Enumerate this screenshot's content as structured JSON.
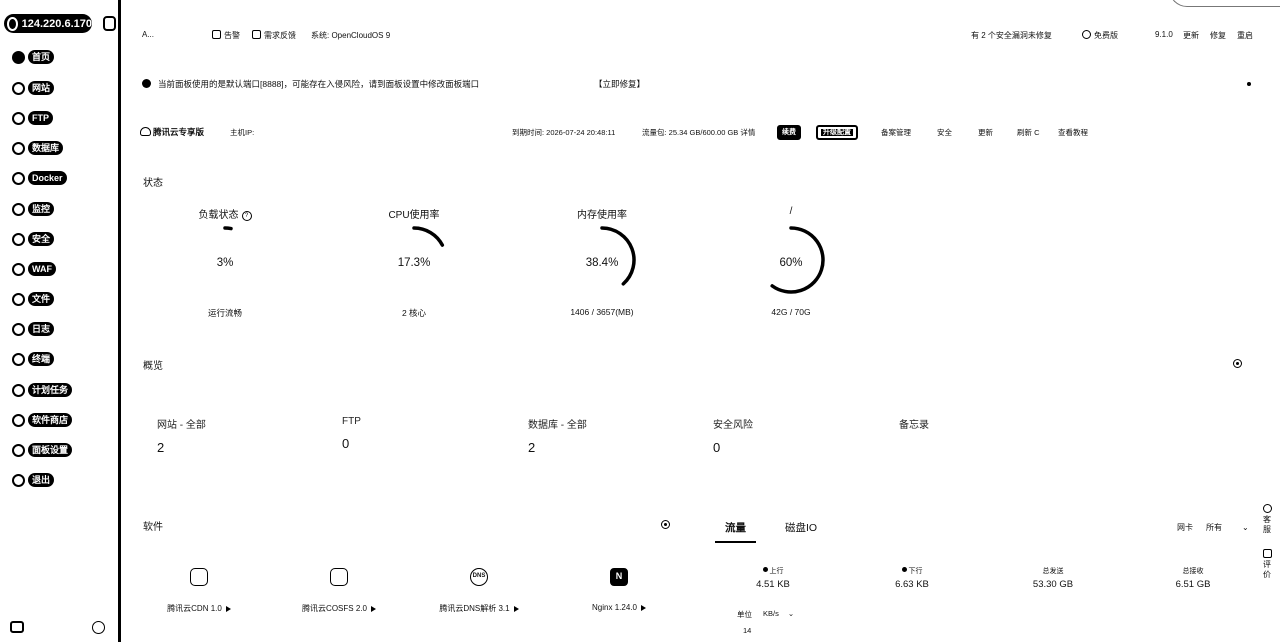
{
  "server": {
    "ip": "124.220.6.170"
  },
  "sidebar": {
    "items": [
      {
        "label": "首页",
        "icon": "home-icon"
      },
      {
        "label": "网站",
        "icon": "globe-icon"
      },
      {
        "label": "FTP",
        "icon": "ftp-icon"
      },
      {
        "label": "数据库",
        "icon": "database-icon"
      },
      {
        "label": "Docker",
        "icon": "docker-icon"
      },
      {
        "label": "监控",
        "icon": "monitor-icon"
      },
      {
        "label": "安全",
        "icon": "shield-icon"
      },
      {
        "label": "WAF",
        "icon": "waf-icon"
      },
      {
        "label": "文件",
        "icon": "folder-icon"
      },
      {
        "label": "日志",
        "icon": "log-icon"
      },
      {
        "label": "终端",
        "icon": "terminal-icon"
      },
      {
        "label": "计划任务",
        "icon": "clock-icon"
      },
      {
        "label": "软件商店",
        "icon": "store-icon"
      },
      {
        "label": "面板设置",
        "icon": "gear-icon"
      },
      {
        "label": "退出",
        "icon": "logout-icon"
      }
    ]
  },
  "topbar": {
    "user": "A...",
    "alert": "告警",
    "feedback": "需求反馈",
    "system": "系统: OpenCloudOS 9",
    "notice": "有 2 个安全漏洞未修复",
    "edition": "免费版",
    "version": "9.1.0",
    "update": "更新",
    "repair": "修复",
    "restart": "重启"
  },
  "warning": {
    "text": "当前面板使用的是默认端口[8888]，可能存在入侵风险，请到面板设置中修改面板端口",
    "link": "【立即修复】"
  },
  "info": {
    "brand": "腾讯云专享版",
    "host": "主机IP:",
    "expire": "到期时间: 2026-07-24 20:48:11",
    "traffic": "流量包: 25.34 GB/600.00 GB 详情",
    "renew_btn": "续费",
    "upgrade_btn": "升级配置",
    "links": [
      "备案管理",
      "安全",
      "更新",
      "刷新 C",
      "查看教程"
    ]
  },
  "status": {
    "title": "状态",
    "load": {
      "title": "负载状态",
      "value": "3%",
      "sub": "运行流畅",
      "percent": 0.03
    },
    "cpu": {
      "title": "CPU使用率",
      "value": "17.3%",
      "sub": "2 核心",
      "percent": 0.173
    },
    "mem": {
      "title": "内存使用率",
      "value": "38.4%",
      "sub": "1406 / 3657(MB)",
      "percent": 0.384
    },
    "disk": {
      "title": "/",
      "value": "60%",
      "sub": "42G / 70G",
      "percent": 0.6
    }
  },
  "overview": {
    "title": "概览",
    "items": [
      {
        "label": "网站 - 全部",
        "value": "2"
      },
      {
        "label": "FTP",
        "value": "0"
      },
      {
        "label": "数据库 - 全部",
        "value": "2"
      },
      {
        "label": "安全风险",
        "value": "0"
      },
      {
        "label": "备忘录",
        "value": ""
      }
    ]
  },
  "software": {
    "title": "软件",
    "items": [
      {
        "name": "腾讯云CDN 1.0",
        "icon": "cdn-icon"
      },
      {
        "name": "腾讯云COSFS 2.0",
        "icon": "cos-icon"
      },
      {
        "name": "腾讯云DNS解析 3.1",
        "icon": "dns-icon",
        "badge": "DNS"
      },
      {
        "name": "Nginx 1.24.0",
        "icon": "nginx-icon",
        "badge": "N"
      }
    ]
  },
  "traffic": {
    "tab_flow": "流量",
    "tab_disk": "磁盘IO",
    "net_label": "网卡",
    "net_value": "所有",
    "upload_label": "上行",
    "upload": "4.51 KB",
    "download_label": "下行",
    "download": "6.63 KB",
    "total_sent_label": "总发送",
    "total_sent": "53.30 GB",
    "total_recv_label": "总接收",
    "total_recv": "6.51 GB",
    "unit_label": "单位",
    "unit": "KB/s",
    "axis_top": "14"
  },
  "right_strip": {
    "service": "客服",
    "review": "评价"
  }
}
